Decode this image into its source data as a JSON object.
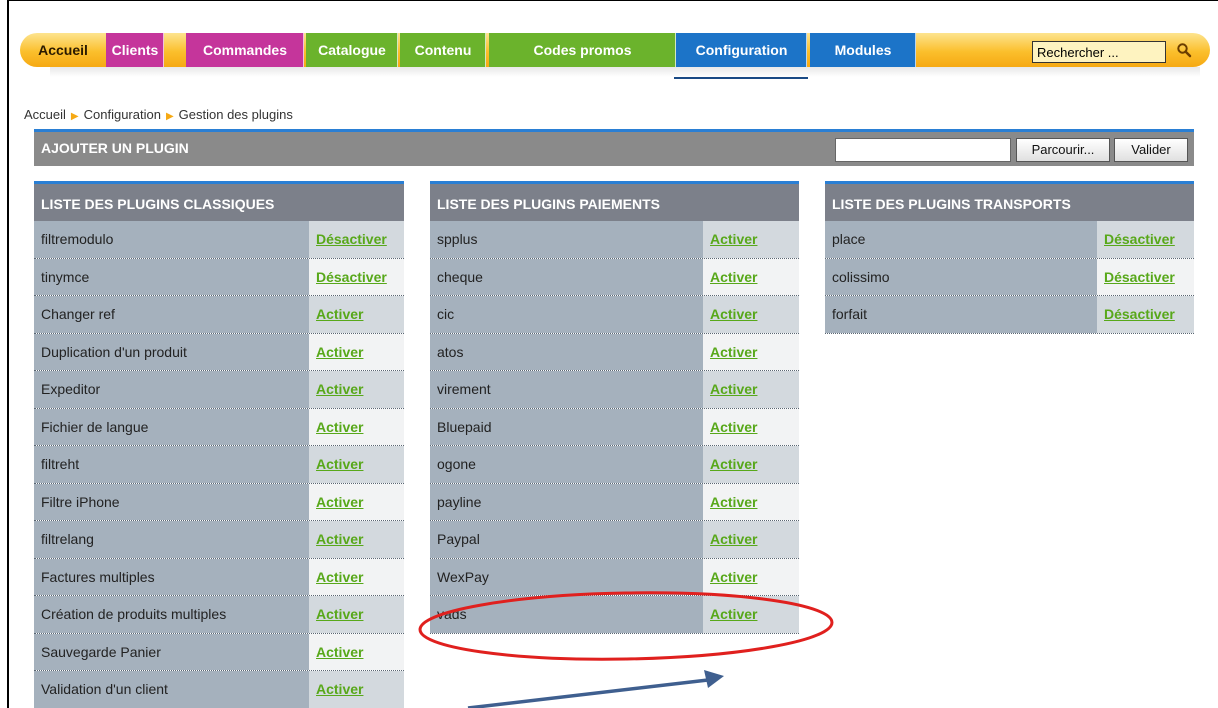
{
  "nav": {
    "items": [
      {
        "label": "Accueil",
        "color": "#fbbf2c"
      },
      {
        "label": "Clients",
        "color": "#c5359b"
      },
      {
        "label": "Commandes",
        "color": "#c5359b"
      },
      {
        "label": "Catalogue",
        "color": "#6bb32c"
      },
      {
        "label": "Contenu",
        "color": "#6bb32c"
      },
      {
        "label": "Codes promos",
        "color": "#6bb32c"
      },
      {
        "label": "Configuration",
        "color": "#1c74c8"
      },
      {
        "label": "Modules",
        "color": "#1c74c8"
      }
    ],
    "search_value": "Rechercher ..."
  },
  "breadcrumb": [
    "Accueil",
    "Configuration",
    "Gestion des plugins"
  ],
  "add_plugin": {
    "title": "AJOUTER UN PLUGIN",
    "browse_label": "Parcourir...",
    "submit_label": "Valider"
  },
  "tables": {
    "classiques": {
      "title": "LISTE DES PLUGINS CLASSIQUES",
      "rows": [
        {
          "name": "filtremodulo",
          "action": "Désactiver"
        },
        {
          "name": "tinymce",
          "action": "Désactiver"
        },
        {
          "name": "Changer ref",
          "action": "Activer"
        },
        {
          "name": "Duplication d'un produit",
          "action": "Activer"
        },
        {
          "name": "Expeditor",
          "action": "Activer"
        },
        {
          "name": "Fichier de langue",
          "action": "Activer"
        },
        {
          "name": "filtreht",
          "action": "Activer"
        },
        {
          "name": "Filtre iPhone",
          "action": "Activer"
        },
        {
          "name": "filtrelang",
          "action": "Activer"
        },
        {
          "name": "Factures multiples",
          "action": "Activer"
        },
        {
          "name": "Création de produits multiples",
          "action": "Activer"
        },
        {
          "name": "Sauvegarde Panier",
          "action": "Activer"
        },
        {
          "name": "Validation d'un client",
          "action": "Activer"
        }
      ]
    },
    "paiements": {
      "title": "LISTE DES PLUGINS PAIEMENTS",
      "rows": [
        {
          "name": "spplus",
          "action": "Activer"
        },
        {
          "name": "cheque",
          "action": "Activer"
        },
        {
          "name": "cic",
          "action": "Activer"
        },
        {
          "name": "atos",
          "action": "Activer"
        },
        {
          "name": "virement",
          "action": "Activer"
        },
        {
          "name": "Bluepaid",
          "action": "Activer"
        },
        {
          "name": "ogone",
          "action": "Activer"
        },
        {
          "name": "payline",
          "action": "Activer"
        },
        {
          "name": "Paypal",
          "action": "Activer"
        },
        {
          "name": "WexPay",
          "action": "Activer"
        },
        {
          "name": "vads",
          "action": "Activer"
        }
      ]
    },
    "transports": {
      "title": "LISTE DES PLUGINS TRANSPORTS",
      "rows": [
        {
          "name": "place",
          "action": "Désactiver"
        },
        {
          "name": "colissimo",
          "action": "Désactiver"
        },
        {
          "name": "forfait",
          "action": "Désactiver"
        }
      ]
    }
  },
  "colors": {
    "accent_blue": "#2a7fd4",
    "link_green": "#58a81a",
    "annotation_red": "#e0201e",
    "annotation_arrow": "#3f5f8f"
  }
}
